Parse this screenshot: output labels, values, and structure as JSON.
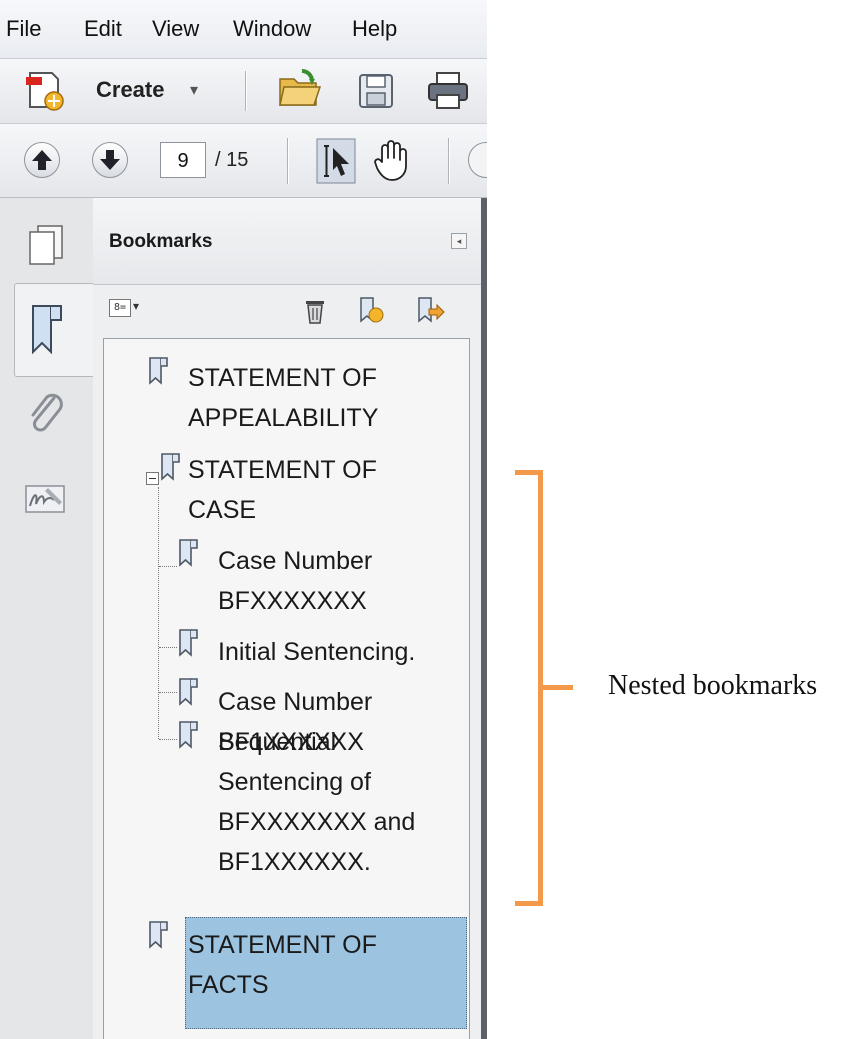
{
  "menubar": {
    "items": [
      "File",
      "Edit",
      "View",
      "Window",
      "Help"
    ]
  },
  "toolbar": {
    "create_label": "Create",
    "create_caret": "▾"
  },
  "navigation": {
    "current_page": "9",
    "page_total": "/ 15"
  },
  "bookmarks_panel": {
    "title": "Bookmarks",
    "collapse_glyph": "◂",
    "options_glyph": "8=",
    "options_caret": "▾",
    "items": [
      {
        "lines": [
          "STATEMENT OF",
          "APPEALABILITY"
        ],
        "level": 0
      },
      {
        "lines": [
          "STATEMENT OF",
          "CASE"
        ],
        "level": 0,
        "expanded": true
      },
      {
        "lines": [
          "Case Number",
          "BFXXXXXXX"
        ],
        "level": 1
      },
      {
        "lines": [
          "Initial Sentencing."
        ],
        "level": 1
      },
      {
        "lines": [
          "Case Number",
          "BF1XXXXXX"
        ],
        "level": 1
      },
      {
        "lines": [
          "Sequential",
          "Sentencing of",
          "BFXXXXXXX and",
          "BF1XXXXXX."
        ],
        "level": 1
      },
      {
        "lines": [
          "STATEMENT OF",
          "FACTS"
        ],
        "level": 0,
        "selected": true
      }
    ]
  },
  "annotation": {
    "label": "Nested bookmarks",
    "color": "#f2994a"
  },
  "colors": {
    "selection": "#9cc3df",
    "bookmark_icon_fill": "#dde6f2",
    "bookmark_icon_stroke": "#4d5866"
  }
}
